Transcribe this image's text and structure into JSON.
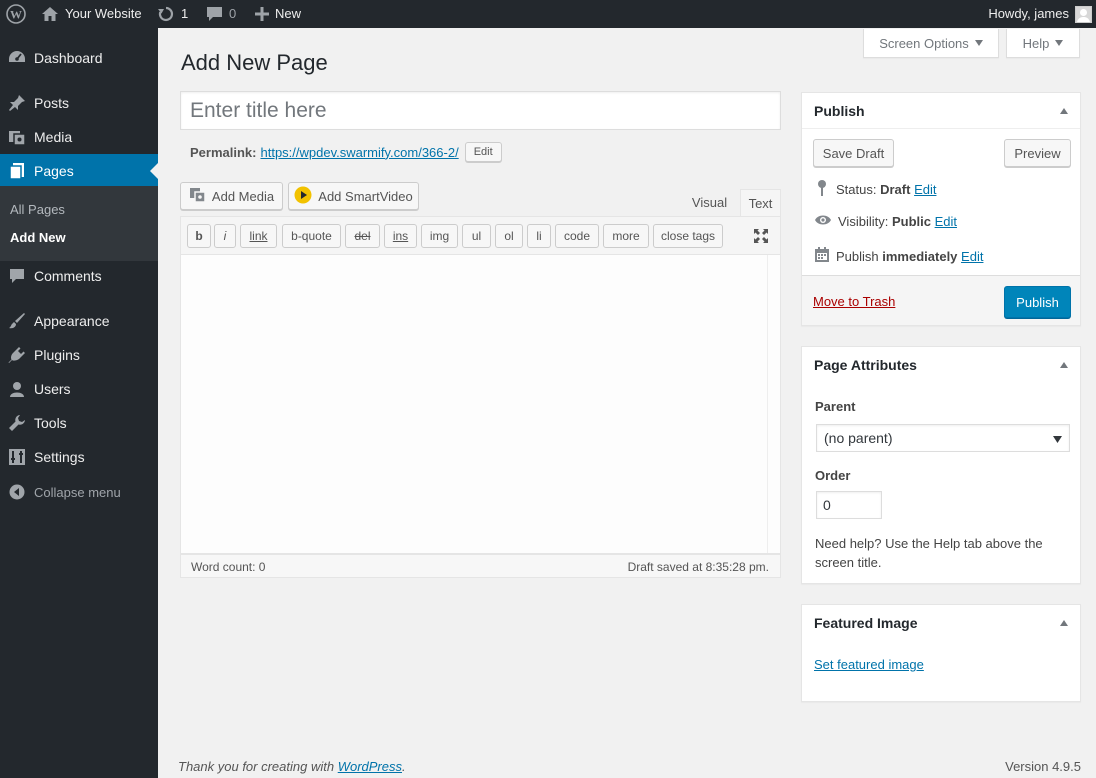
{
  "adminbar": {
    "site_name": "Your Website",
    "updates_count": "1",
    "comments_count": "0",
    "new_label": "New",
    "howdy": "Howdy, james"
  },
  "sidebar": {
    "items": [
      {
        "label": "Dashboard",
        "icon": "dashboard-icon"
      },
      {
        "label": "Posts",
        "icon": "pin-icon"
      },
      {
        "label": "Media",
        "icon": "media-icon"
      },
      {
        "label": "Pages",
        "icon": "pages-icon"
      },
      {
        "label": "Comments",
        "icon": "comment-icon"
      },
      {
        "label": "Appearance",
        "icon": "brush-icon"
      },
      {
        "label": "Plugins",
        "icon": "plugin-icon"
      },
      {
        "label": "Users",
        "icon": "users-icon"
      },
      {
        "label": "Tools",
        "icon": "wrench-icon"
      },
      {
        "label": "Settings",
        "icon": "settings-icon"
      }
    ],
    "submenu": [
      "All Pages",
      "Add New"
    ],
    "collapse": "Collapse menu"
  },
  "screen_options": {
    "label": "Screen Options"
  },
  "help": {
    "label": "Help"
  },
  "page_title": "Add New Page",
  "title_field": {
    "placeholder": "Enter title here",
    "value": ""
  },
  "permalink": {
    "label": "Permalink:",
    "url": "https://wpdev.swarmify.com/366-2/",
    "edit": "Edit"
  },
  "media_buttons": {
    "add_media": "Add Media",
    "add_smartvideo": "Add SmartVideo"
  },
  "editor_tabs": {
    "visual": "Visual",
    "text": "Text"
  },
  "quicktags": [
    "b",
    "i",
    "link",
    "b-quote",
    "del",
    "ins",
    "img",
    "ul",
    "ol",
    "li",
    "code",
    "more",
    "close tags"
  ],
  "status_bar": {
    "word_count": "Word count: 0",
    "draft_saved": "Draft saved at 8:35:28 pm."
  },
  "publish_box": {
    "title": "Publish",
    "save_draft": "Save Draft",
    "preview": "Preview",
    "status_label": "Status:",
    "status_value": "Draft",
    "visibility_label": "Visibility:",
    "visibility_value": "Public",
    "publish_label": "Publish",
    "publish_value": "immediately",
    "edit": "Edit",
    "trash": "Move to Trash",
    "publish_button": "Publish"
  },
  "attributes_box": {
    "title": "Page Attributes",
    "parent_label": "Parent",
    "parent_value": "(no parent)",
    "order_label": "Order",
    "order_value": "0",
    "help_text": "Need help? Use the Help tab above the screen title."
  },
  "featured_box": {
    "title": "Featured Image",
    "link": "Set featured image"
  },
  "footer": {
    "thanks": "Thank you for creating with",
    "wp_link": "WordPress",
    "period": ".",
    "version": "Version 4.9.5"
  },
  "colors": {
    "accent": "#0073aa",
    "sidebar": "#23282d",
    "publish": "#0085ba"
  }
}
